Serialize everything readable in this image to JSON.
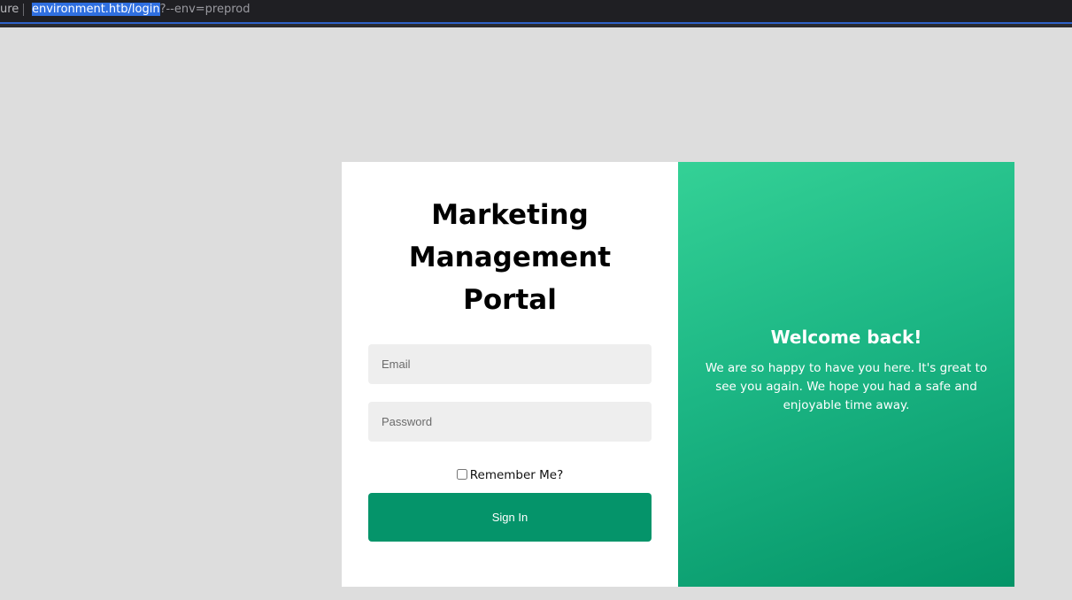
{
  "browser": {
    "url_prefix": "ure",
    "url_selected": "environment.htb/login",
    "url_rest": "?--env=preprod"
  },
  "login": {
    "title_lines": [
      "Marketing",
      "Management",
      "Portal"
    ],
    "email_placeholder": "Email",
    "password_placeholder": "Password",
    "remember_label": "Remember Me?",
    "signin_label": "Sign In"
  },
  "welcome": {
    "title": "Welcome back!",
    "text": "We are so happy to have you here. It's great to see you again. We hope you had a safe and enjoyable time away."
  },
  "colors": {
    "page_bg": "#dddddd",
    "accent": "#05946a",
    "gradient_start": "#34d196",
    "gradient_end": "#049467"
  }
}
